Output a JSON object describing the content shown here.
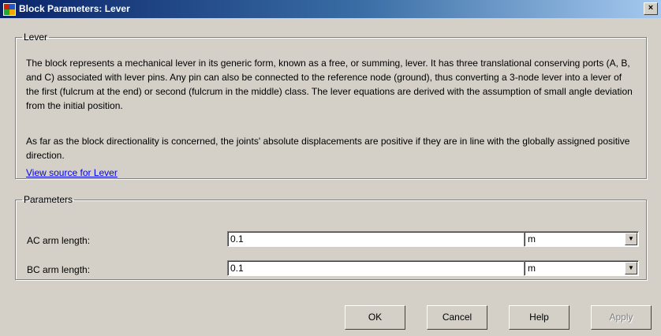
{
  "window": {
    "title": "Block Parameters: Lever",
    "close_glyph": "×"
  },
  "lever_group": {
    "legend": "Lever",
    "paragraph1": "The block represents a mechanical lever in its generic form, known as a free, or summing, lever. It has three translational conserving ports (A, B, and C) associated with lever pins. Any pin can also be connected to the reference node (ground), thus converting a 3-node lever into a lever of the first (fulcrum at the end) or second (fulcrum in the middle) class. The lever equations are derived with the assumption of small angle deviation from the initial position.",
    "paragraph2": "As far as the block directionality is concerned, the joints' absolute displacements are positive if they are in line with the globally assigned positive direction.",
    "link": "View source for Lever"
  },
  "parameters": {
    "legend": "Parameters",
    "rows": [
      {
        "label": "AC arm length:",
        "value": "0.1",
        "unit": "m"
      },
      {
        "label": "BC arm length:",
        "value": "0.1",
        "unit": "m"
      }
    ]
  },
  "buttons": {
    "ok": "OK",
    "cancel": "Cancel",
    "help": "Help",
    "apply": "Apply"
  },
  "icons": {
    "app": "simulink-block-icon",
    "dropdown": "chevron-down-icon"
  }
}
